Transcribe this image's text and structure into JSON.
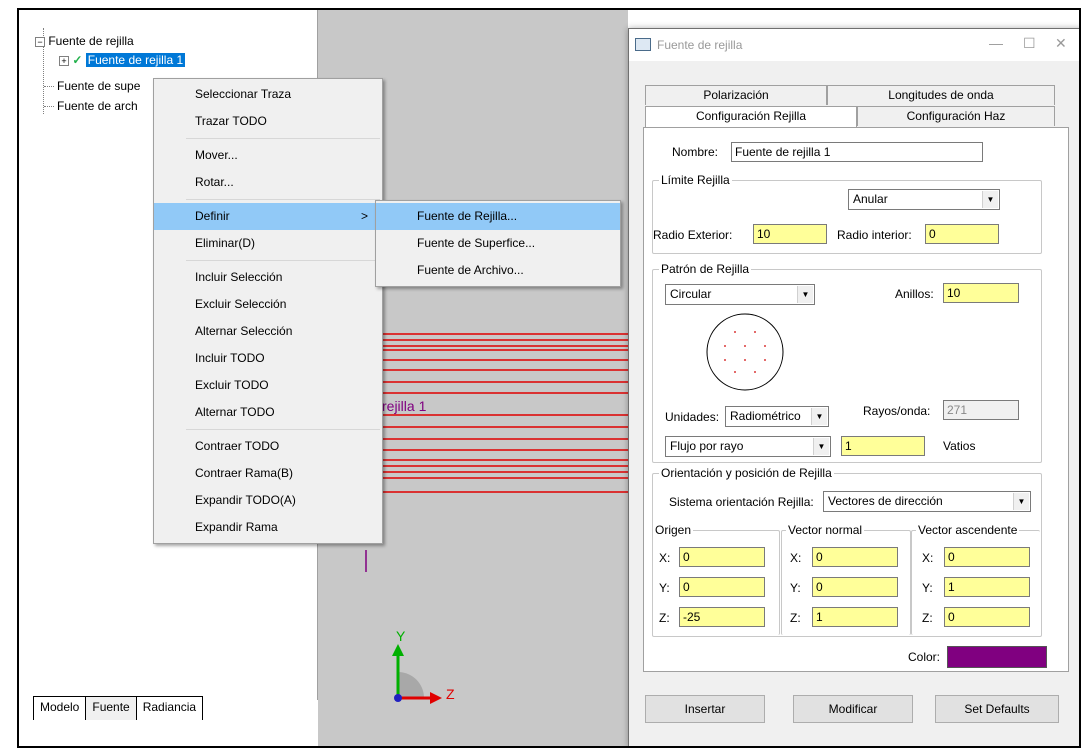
{
  "tree": {
    "root_label": "Fuente de rejilla",
    "child_label": "Fuente de rejilla 1",
    "item2_label": "Fuente de supe",
    "item3_label": "Fuente de arch"
  },
  "bottom_tabs": [
    "Modelo",
    "Fuente",
    "Radiancia"
  ],
  "viewport": {
    "object_label": "rejilla 1",
    "axis_y": "Y",
    "axis_z": "Z"
  },
  "context_menu": {
    "items": [
      "Seleccionar Traza",
      "Trazar TODO",
      "Mover...",
      "Rotar...",
      "Definir",
      "Eliminar(D)",
      "Incluir Selección",
      "Excluir Selección",
      "Alternar Selección",
      "Incluir TODO",
      "Excluir TODO",
      "Alternar TODO",
      "Contraer TODO",
      "Contraer Rama(B)",
      "Expandir TODO(A)",
      "Expandir Rama"
    ],
    "submenu_arrow": ">"
  },
  "submenu": {
    "items": [
      "Fuente de Rejilla...",
      "Fuente de Superfice...",
      "Fuente de Archivo..."
    ]
  },
  "dialog": {
    "title": "Fuente de rejilla",
    "tabs_back": [
      "Polarización",
      "Longitudes de onda"
    ],
    "tabs_front": [
      "Configuración Rejilla",
      "Configuración Haz"
    ],
    "nombre_label": "Nombre:",
    "nombre_value": "Fuente de rejilla 1",
    "limite": {
      "title": "Límite Rejilla",
      "shape_value": "Anular",
      "radio_ext_label": "Radio Exterior:",
      "radio_ext_value": "10",
      "radio_int_label": "Radio interior:",
      "radio_int_value": "0"
    },
    "patron": {
      "title": "Patrón de Rejilla",
      "pattern_value": "Circular",
      "anillos_label": "Anillos:",
      "anillos_value": "10",
      "unidades_label": "Unidades:",
      "unidades_value": "Radiométrico",
      "rayos_label": "Rayos/onda:",
      "rayos_value": "271",
      "flujo_value": "Flujo por rayo",
      "flujo_amount": "1",
      "vatios_label": "Vatios"
    },
    "orientacion": {
      "title": "Orientación y posición de Rejilla",
      "sistema_label": "Sistema orientación Rejilla:",
      "sistema_value": "Vectores de dirección",
      "origen": {
        "title": "Origen",
        "x": "0",
        "y": "0",
        "z": "-25"
      },
      "normal": {
        "title": "Vector normal",
        "x": "0",
        "y": "0",
        "z": "1"
      },
      "ascendente": {
        "title": "Vector ascendente",
        "x": "0",
        "y": "1",
        "z": "0"
      },
      "x_label": "X:",
      "y_label": "Y:",
      "z_label": "Z:"
    },
    "color_label": "Color:",
    "color_value": "#800080",
    "buttons": {
      "insertar": "Insertar",
      "modificar": "Modificar",
      "defaults": "Set Defaults"
    }
  }
}
